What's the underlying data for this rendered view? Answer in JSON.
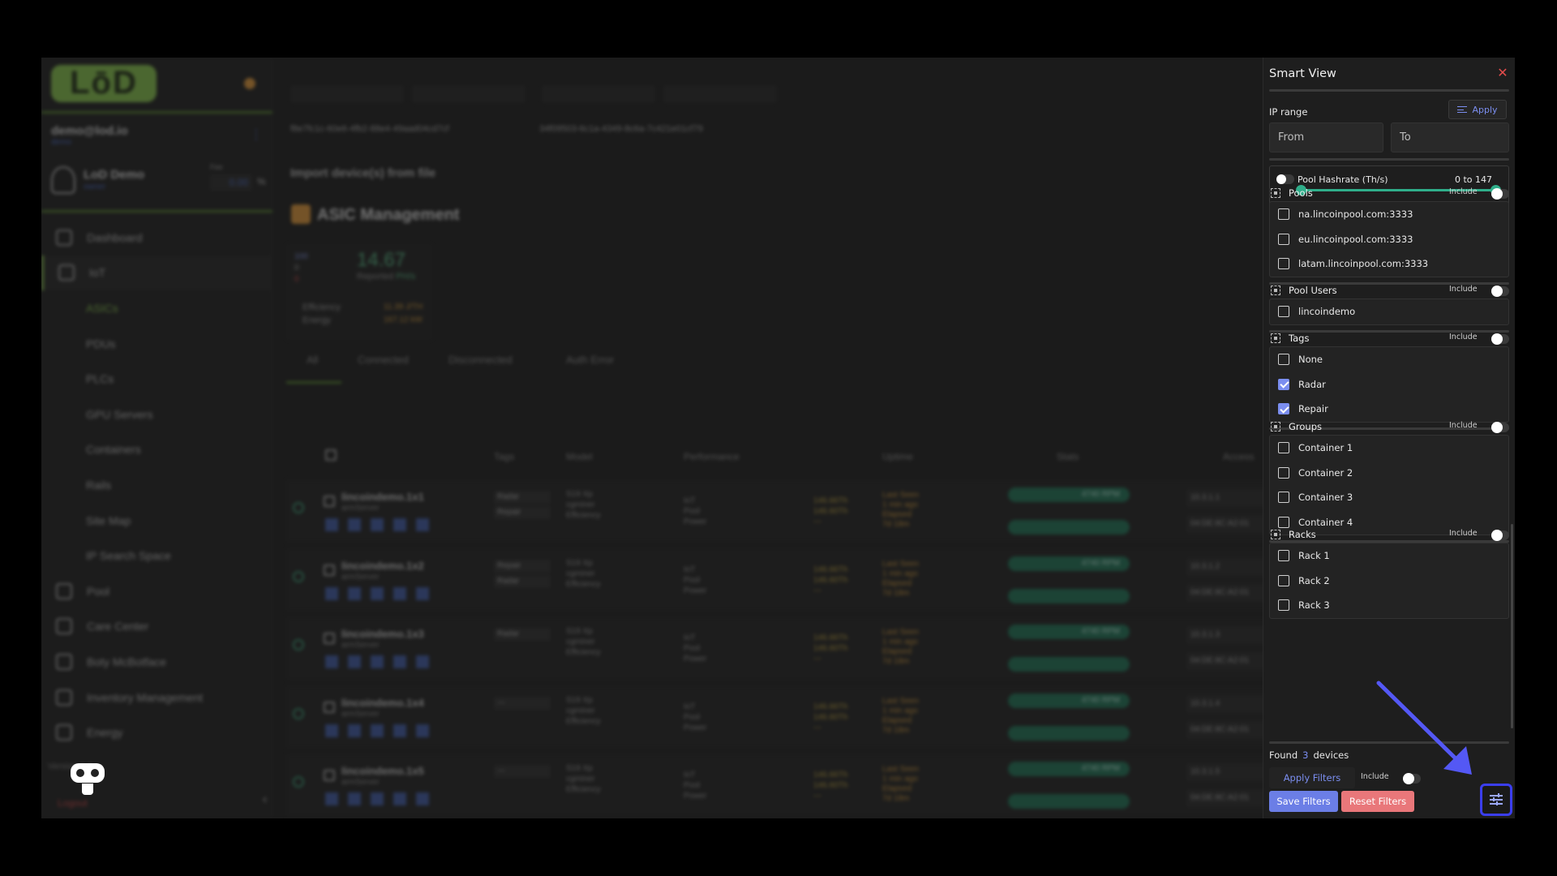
{
  "background": {
    "brand": "LōD",
    "account": {
      "email": "demo@lod.io",
      "sub": "demo"
    },
    "user": {
      "name": "LoD Demo",
      "role": "owner",
      "fee_label": "Fee",
      "fee_value": "0.00",
      "fee_unit": "%"
    },
    "nav": [
      {
        "label": "Dashboard",
        "kind": "top"
      },
      {
        "label": "IoT",
        "kind": "active"
      },
      {
        "label": "ASICs",
        "kind": "sub-green"
      },
      {
        "label": "PDUs",
        "kind": "sub"
      },
      {
        "label": "PLCs",
        "kind": "sub"
      },
      {
        "label": "GPU Servers",
        "kind": "sub"
      },
      {
        "label": "Containers",
        "kind": "sub"
      },
      {
        "label": "Rails",
        "kind": "sub"
      },
      {
        "label": "Site Map",
        "kind": "sub"
      },
      {
        "label": "IP Search Space",
        "kind": "sub"
      },
      {
        "label": "Pool",
        "kind": "top"
      },
      {
        "label": "Care Center",
        "kind": "top"
      },
      {
        "label": "Boty McBotface",
        "kind": "top"
      },
      {
        "label": "Inventory Management",
        "kind": "top"
      },
      {
        "label": "Energy",
        "kind": "top"
      }
    ],
    "version": "Version 1.0",
    "logout": "Logout",
    "uuids": [
      "f8e7fc1c-60e6-4fb2-88e4-49aad04cd7cf",
      "34f09503-6c1a-4349-8c6a-7c421e01cf79"
    ],
    "import_text": "Import device(s) from file",
    "section_title": "ASIC Management",
    "stats": {
      "count_online": "100",
      "count_2": "0",
      "count_3": "0",
      "hashrate": "14.67",
      "hashrate_label": "Reported",
      "hashrate_unit": "PH/s",
      "efficiency_label": "Efficiency",
      "efficiency_value": "11.39 J/TH",
      "energy_label": "Energy",
      "energy_value": "167.12 kW"
    },
    "tabs": [
      "All",
      "Connected",
      "Disconnected",
      "Auth Error"
    ],
    "columns": [
      "Tags",
      "Model",
      "Performance",
      "Uptime",
      "Stats",
      "Access"
    ],
    "rows": [
      {
        "name": "lincoindemo.1x1",
        "sub": "armServer",
        "tags": [
          "Radar",
          "Repair"
        ],
        "ip": "10.3.1.1",
        "mac": "04:DE:8C:A2:01"
      },
      {
        "name": "lincoindemo.1x2",
        "sub": "armServer",
        "tags": [
          "Repair",
          "Radar"
        ],
        "ip": "10.3.1.2",
        "mac": "04:DE:8C:A2:01"
      },
      {
        "name": "lincoindemo.1x3",
        "sub": "armServer",
        "tags": [
          "Radar"
        ],
        "ip": "10.3.1.3",
        "mac": "04:DE:8C:A2:01"
      },
      {
        "name": "lincoindemo.1x4",
        "sub": "armServer",
        "tags": [
          "---"
        ],
        "ip": "10.3.1.4",
        "mac": "04:DE:8C:A2:01"
      },
      {
        "name": "lincoindemo.1x5",
        "sub": "armServer",
        "tags": [
          "---"
        ],
        "ip": "10.3.1.5",
        "mac": "04:DE:8C:A2:01"
      }
    ],
    "row_model": [
      "S19 Xp",
      "cgminer",
      "Efficiency"
    ],
    "row_perf_labels": [
      "IoT",
      "Pool",
      "Power"
    ],
    "row_perf_values": [
      "146.66Th",
      "146.60Th",
      "---"
    ],
    "row_uptime": [
      "Last Seen",
      "1 min ago",
      "Elapsed",
      "7d 18m"
    ],
    "row_rpm": "4740 RPM"
  },
  "panel": {
    "title": "Smart View",
    "ip_range_label": "IP range",
    "apply_label": "Apply",
    "from_placeholder": "From",
    "to_placeholder": "To",
    "hashrate_label": "Pool Hashrate (Th/s)",
    "hashrate_range": "0 to 147",
    "hashrate_min": 0,
    "hashrate_max": 147,
    "include_label": "Include",
    "sections": [
      {
        "title": "Pools",
        "options": [
          {
            "label": "na.lincoinpool.com:3333",
            "checked": false
          },
          {
            "label": "eu.lincoinpool.com:3333",
            "checked": false
          },
          {
            "label": "latam.lincoinpool.com:3333",
            "checked": false
          }
        ]
      },
      {
        "title": "Pool Users",
        "options": [
          {
            "label": "lincoindemo",
            "checked": false
          }
        ]
      },
      {
        "title": "Tags",
        "options": [
          {
            "label": "None",
            "checked": false
          },
          {
            "label": "Radar",
            "checked": true
          },
          {
            "label": "Repair",
            "checked": true
          }
        ]
      },
      {
        "title": "Groups",
        "options": [
          {
            "label": "Container 1",
            "checked": false
          },
          {
            "label": "Container 2",
            "checked": false
          },
          {
            "label": "Container 3",
            "checked": false
          },
          {
            "label": "Container 4",
            "checked": false
          }
        ]
      },
      {
        "title": "Racks",
        "options": [
          {
            "label": "Rack 1",
            "checked": false
          },
          {
            "label": "Rack 2",
            "checked": false
          },
          {
            "label": "Rack 3",
            "checked": false
          }
        ]
      }
    ],
    "found_prefix": "Found",
    "found_count": "3",
    "found_suffix": "devices",
    "apply_filters_label": "Apply Filters",
    "save_filters_label": "Save Filters",
    "reset_filters_label": "Reset Filters",
    "accent_color": "#7b8ef0",
    "close_icon": "close-icon",
    "fab_icon": "sliders-icon"
  }
}
